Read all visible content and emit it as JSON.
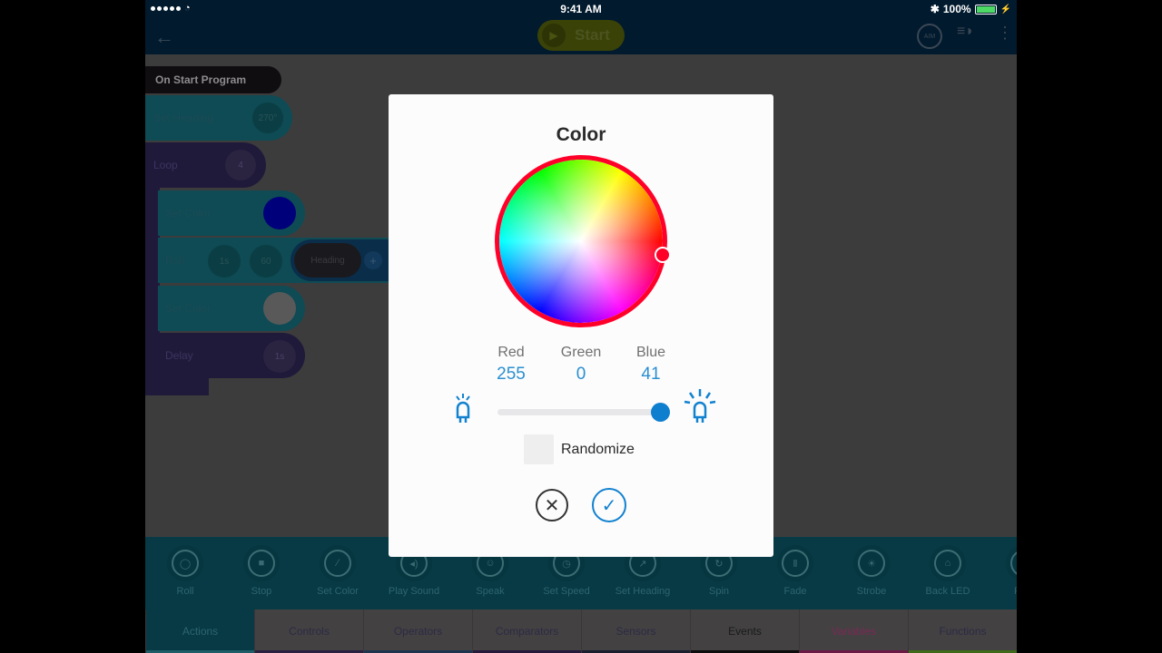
{
  "status_bar": {
    "time": "9:41 AM",
    "battery": "100%",
    "battery_level": 1.0
  },
  "nav": {
    "back_icon": "arrow-left-icon",
    "start_label": "Start",
    "aim_label": "AIM",
    "icons": [
      "aim-icon",
      "drive-icon",
      "more-vertical-icon"
    ]
  },
  "canvas": {
    "blocks": [
      {
        "label": "On Start Program"
      },
      {
        "label": "Set Heading",
        "value": "270°"
      },
      {
        "label": "Loop",
        "value": "4"
      },
      {
        "label": "Set Color",
        "color": "#00007a"
      },
      {
        "label": "Roll",
        "values": [
          "1s",
          "60",
          "Heading"
        ],
        "add": "+"
      },
      {
        "label": "Set Color",
        "color": "#ffffff"
      },
      {
        "label": "Delay",
        "value": "1s"
      }
    ]
  },
  "dialog": {
    "title": "Color",
    "selected_color": "#ff0029",
    "channels": [
      {
        "name": "Red",
        "value": "255"
      },
      {
        "name": "Green",
        "value": "0"
      },
      {
        "name": "Blue",
        "value": "41"
      }
    ],
    "brightness_fraction": 0.96,
    "randomize_label": "Randomize",
    "randomize_checked": false,
    "cancel_icon": "close-icon",
    "confirm_icon": "check-icon"
  },
  "palette": {
    "items": [
      {
        "label": "Roll",
        "icon": "roll-icon"
      },
      {
        "label": "Stop",
        "icon": "stop-icon"
      },
      {
        "label": "Set Color",
        "icon": "dropper-icon"
      },
      {
        "label": "Play Sound",
        "icon": "sound-icon"
      },
      {
        "label": "Speak",
        "icon": "speak-icon"
      },
      {
        "label": "Set Speed",
        "icon": "speed-icon"
      },
      {
        "label": "Set Heading",
        "icon": "compass-icon"
      },
      {
        "label": "Spin",
        "icon": "spin-icon"
      },
      {
        "label": "Fade",
        "icon": "fade-icon"
      },
      {
        "label": "Strobe",
        "icon": "strobe-icon"
      },
      {
        "label": "Back LED",
        "icon": "back-led-icon"
      },
      {
        "label": "Raw",
        "icon": "raw-icon"
      }
    ]
  },
  "tabs": [
    {
      "label": "Actions",
      "color": "#1d5e68",
      "active": true
    },
    {
      "label": "Controls",
      "color": "#2a2040"
    },
    {
      "label": "Operators",
      "color": "#1e3550"
    },
    {
      "label": "Comparators",
      "color": "#251a3c"
    },
    {
      "label": "Sensors",
      "color": "#1a1f2e"
    },
    {
      "label": "Events",
      "color": "#0d0d0d"
    },
    {
      "label": "Variables",
      "color": "#6a1a45"
    },
    {
      "label": "Functions",
      "color": "#3f6a1a"
    }
  ]
}
